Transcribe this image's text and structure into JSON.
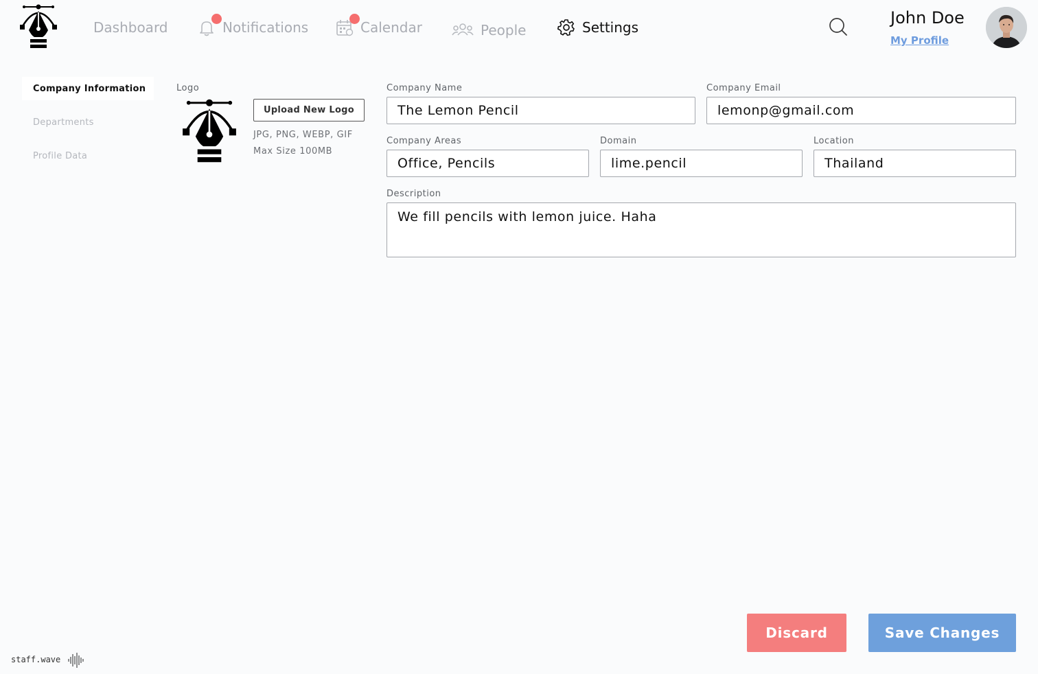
{
  "nav": {
    "items": [
      {
        "label": "Dashboard",
        "icon": "dashboard",
        "active": false,
        "badge": false
      },
      {
        "label": "Notifications",
        "icon": "bell-icon",
        "active": false,
        "badge": true
      },
      {
        "label": "Calendar",
        "icon": "calendar-icon",
        "active": false,
        "badge": true
      },
      {
        "label": "People",
        "icon": "people-icon",
        "active": false,
        "badge": false
      },
      {
        "label": "Settings",
        "icon": "gear-icon",
        "active": true,
        "badge": false
      }
    ]
  },
  "user": {
    "name": "John Doe",
    "profile_link": "My Profile"
  },
  "sidebar": {
    "items": [
      {
        "label": "Company Information",
        "active": true
      },
      {
        "label": "Departments",
        "active": false
      },
      {
        "label": "Profile Data",
        "active": false
      }
    ]
  },
  "form": {
    "logo_label": "Logo",
    "upload_button": "Upload New Logo",
    "formats_hint": "JPG, PNG, WEBP, GIF",
    "size_hint": "Max Size 100MB",
    "company_name": {
      "label": "Company Name",
      "value": "The Lemon Pencil"
    },
    "company_email": {
      "label": "Company Email",
      "value": "lemonp@gmail.com"
    },
    "company_areas": {
      "label": "Company Areas",
      "value": "Office, Pencils"
    },
    "domain": {
      "label": "Domain",
      "value": "lime.pencil"
    },
    "location": {
      "label": "Location",
      "value": "Thailand"
    },
    "description": {
      "label": "Description",
      "value": "We fill pencils with lemon juice. Haha"
    }
  },
  "actions": {
    "discard": "Discard",
    "save": "Save Changes"
  },
  "footer": {
    "brand": "staff.wave"
  },
  "colors": {
    "accent_blue": "#6ea0dc",
    "discard_red": "#f47e7e",
    "badge_red": "#f56e6e",
    "link_blue": "#6e9cde",
    "inactive_nav": "#a9acb3"
  }
}
